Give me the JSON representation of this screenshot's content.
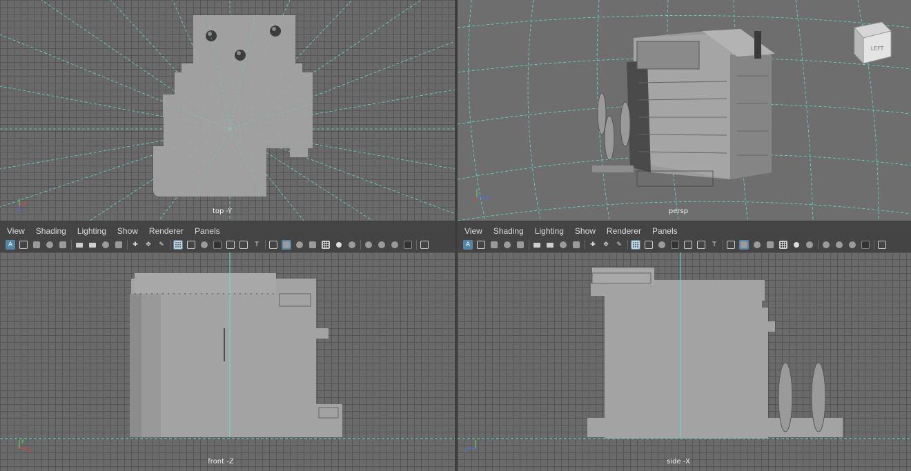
{
  "viewports": {
    "top": {
      "label": "top -Y"
    },
    "persp": {
      "label": "persp",
      "viewcube": "LEFT"
    },
    "front": {
      "label": "front -Z"
    },
    "side": {
      "label": "side -X"
    }
  },
  "panel_menu": [
    "View",
    "Shading",
    "Lighting",
    "Show",
    "Renderer",
    "Panels"
  ],
  "toolbar_icons": [
    "select-camera-icon",
    "camera-attributes-icon",
    "bookmark-icon",
    "image-plane-icon",
    "grid-toggle-icon",
    "film-gate-icon",
    "resolution-gate-icon",
    "gate-mask-icon",
    "field-chart-icon",
    "safe-action-icon",
    "safe-title-icon",
    "wireframe-icon",
    "smooth-shade-icon",
    "wireframe-on-shaded-icon",
    "default-material-icon",
    "textured-icon",
    "use-all-lights-icon",
    "shadows-icon",
    "ambient-occlusion-icon",
    "motion-blur-icon",
    "anti-aliasing-icon",
    "depth-of-field-icon",
    "isolate-select-icon",
    "xray-icon",
    "xray-joints-icon",
    "backface-culling-icon"
  ],
  "axes": {
    "x": "x",
    "y": "y",
    "z": "z"
  },
  "colors": {
    "viewport_bg": "#6a6a6a",
    "grid_line": "#545454",
    "axis_cyan": "#5ee0d0",
    "model_gray": "#a3a3a3",
    "toolbar_highlight": "#5285a6",
    "panel_bg": "#444444"
  }
}
